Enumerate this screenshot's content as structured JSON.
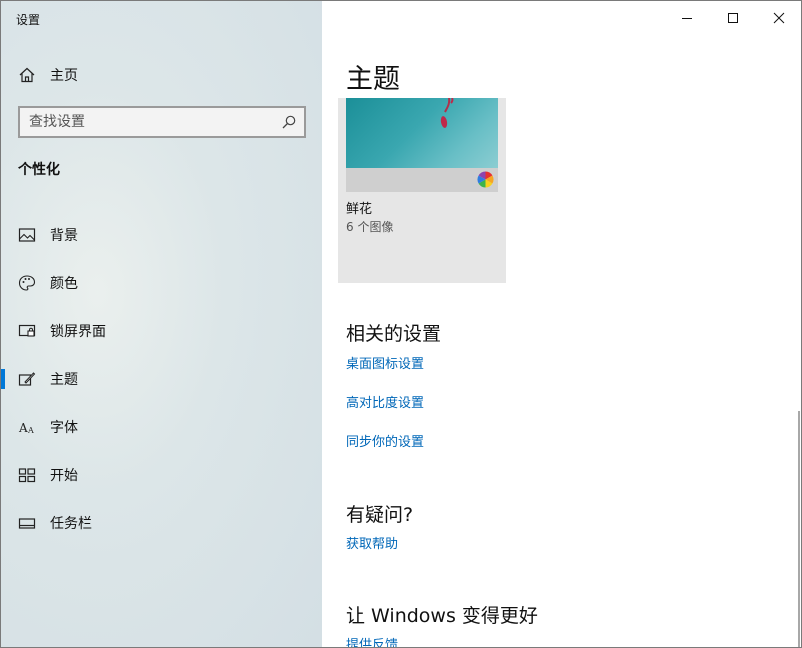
{
  "window": {
    "title": "设置"
  },
  "sidebar": {
    "home_label": "主页",
    "search": {
      "placeholder": "查找设置",
      "value": ""
    },
    "section_title": "个性化",
    "items": [
      {
        "label": "背景",
        "icon": "picture-icon"
      },
      {
        "label": "颜色",
        "icon": "palette-icon"
      },
      {
        "label": "锁屏界面",
        "icon": "lock-screen-icon"
      },
      {
        "label": "主题",
        "icon": "theme-brush-icon",
        "selected": true
      },
      {
        "label": "字体",
        "icon": "font-icon"
      },
      {
        "label": "开始",
        "icon": "start-icon"
      },
      {
        "label": "任务栏",
        "icon": "taskbar-icon"
      }
    ]
  },
  "main": {
    "page_title": "主题",
    "theme": {
      "name": "鲜花",
      "count": "6 个图像"
    },
    "related": {
      "title": "相关的设置",
      "links": [
        "桌面图标设置",
        "高对比度设置",
        "同步你的设置"
      ]
    },
    "help": {
      "title": "有疑问?",
      "link": "获取帮助"
    },
    "feedback": {
      "title": "让 Windows 变得更好",
      "link": "提供反馈"
    }
  },
  "colors": {
    "accent": "#0078d7",
    "link": "#0067b8"
  }
}
